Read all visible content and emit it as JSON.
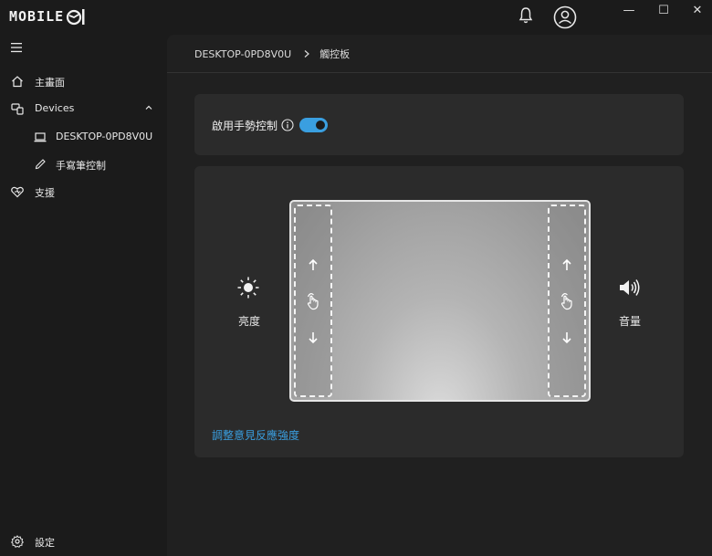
{
  "app": {
    "logo_text": "MOBILE",
    "logo_mark": "01"
  },
  "titlebar": {
    "bell_icon": "bell-icon",
    "account_icon": "user-circle-icon",
    "minimize": "—",
    "maximize": "☐",
    "close": "✕"
  },
  "sidebar": {
    "items": [
      {
        "label": "主畫面",
        "icon": "home-icon"
      },
      {
        "label": "Devices",
        "icon": "devices-icon"
      },
      {
        "label": "DESKTOP-0PD8V0U",
        "icon": "laptop-icon"
      },
      {
        "label": "手寫筆控制",
        "icon": "pen-icon"
      },
      {
        "label": "支援",
        "icon": "heart-support-icon"
      }
    ],
    "settings_label": "設定"
  },
  "breadcrumb": {
    "device": "DESKTOP-0PD8V0U",
    "page": "觸控板"
  },
  "gesture": {
    "label": "啟用手勢控制",
    "enabled": true
  },
  "touchpad": {
    "left_label": "亮度",
    "right_label": "音量",
    "feedback_link": "調整意見反應強度"
  },
  "colors": {
    "accent": "#3a9fe0",
    "background": "#1b1b1b",
    "card": "#2b2b2b"
  }
}
